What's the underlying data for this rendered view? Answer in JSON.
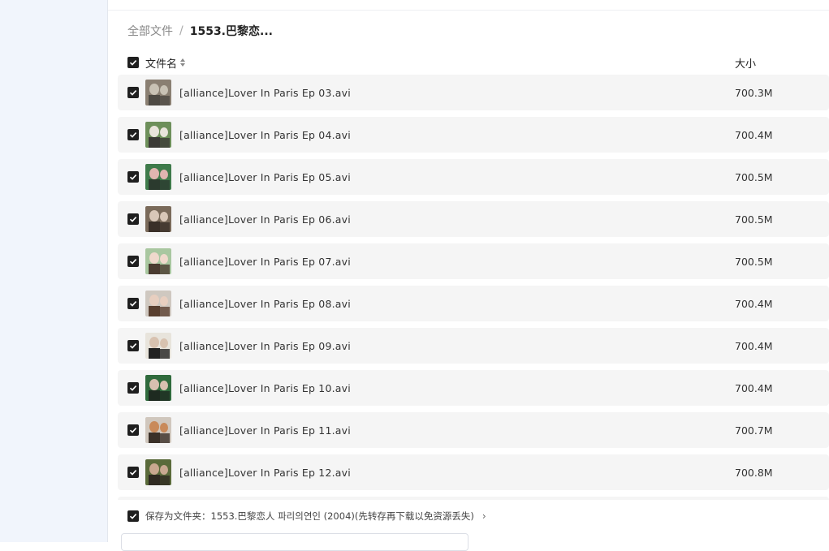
{
  "breadcrumb": {
    "root": "全部文件",
    "separator": "/",
    "current": "1553.巴黎恋..."
  },
  "header": {
    "name_label": "文件名",
    "size_label": "大小"
  },
  "files": [
    {
      "name": "[alliance]Lover In Paris Ep 03.avi",
      "size": "700.3M",
      "thumb_colors": [
        "#8a7f72",
        "#c9c2b5",
        "#4e4a44"
      ]
    },
    {
      "name": "[alliance]Lover In Paris Ep 04.avi",
      "size": "700.4M",
      "thumb_colors": [
        "#6d8f5a",
        "#e9e4dc",
        "#3b3a36"
      ]
    },
    {
      "name": "[alliance]Lover In Paris Ep 05.avi",
      "size": "700.5M",
      "thumb_colors": [
        "#3e7a4a",
        "#e0b5b0",
        "#2b3a2e"
      ]
    },
    {
      "name": "[alliance]Lover In Paris Ep 06.avi",
      "size": "700.5M",
      "thumb_colors": [
        "#7a6a5a",
        "#d9c7b8",
        "#3a2f28"
      ]
    },
    {
      "name": "[alliance]Lover In Paris Ep 07.avi",
      "size": "700.5M",
      "thumb_colors": [
        "#a9c7a0",
        "#f0d9cc",
        "#4a3b30"
      ]
    },
    {
      "name": "[alliance]Lover In Paris Ep 08.avi",
      "size": "700.4M",
      "thumb_colors": [
        "#cfc8c0",
        "#e8cfc0",
        "#5a4030"
      ]
    },
    {
      "name": "[alliance]Lover In Paris Ep 09.avi",
      "size": "700.4M",
      "thumb_colors": [
        "#e8e4dc",
        "#d8c2b0",
        "#222222"
      ]
    },
    {
      "name": "[alliance]Lover In Paris Ep 10.avi",
      "size": "700.4M",
      "thumb_colors": [
        "#2f6a3c",
        "#d8c0b0",
        "#1e2a20"
      ]
    },
    {
      "name": "[alliance]Lover In Paris Ep 11.avi",
      "size": "700.7M",
      "thumb_colors": [
        "#d0c7bd",
        "#c98a5a",
        "#3a3028"
      ]
    },
    {
      "name": "[alliance]Lover In Paris Ep 12.avi",
      "size": "700.8M",
      "thumb_colors": [
        "#5a6a3a",
        "#c9a890",
        "#2f2a22"
      ]
    }
  ],
  "footer": {
    "save_label": "保存为文件夹：1553.巴黎恋人 파리의연인 (2004)(先转存再下载以免资源丢失)",
    "chevron": "›"
  },
  "colors": {
    "sidebar_bg": "#f1f5fc",
    "row_bg": "#f5f5f5",
    "checkbox": "#1f1f1f"
  }
}
